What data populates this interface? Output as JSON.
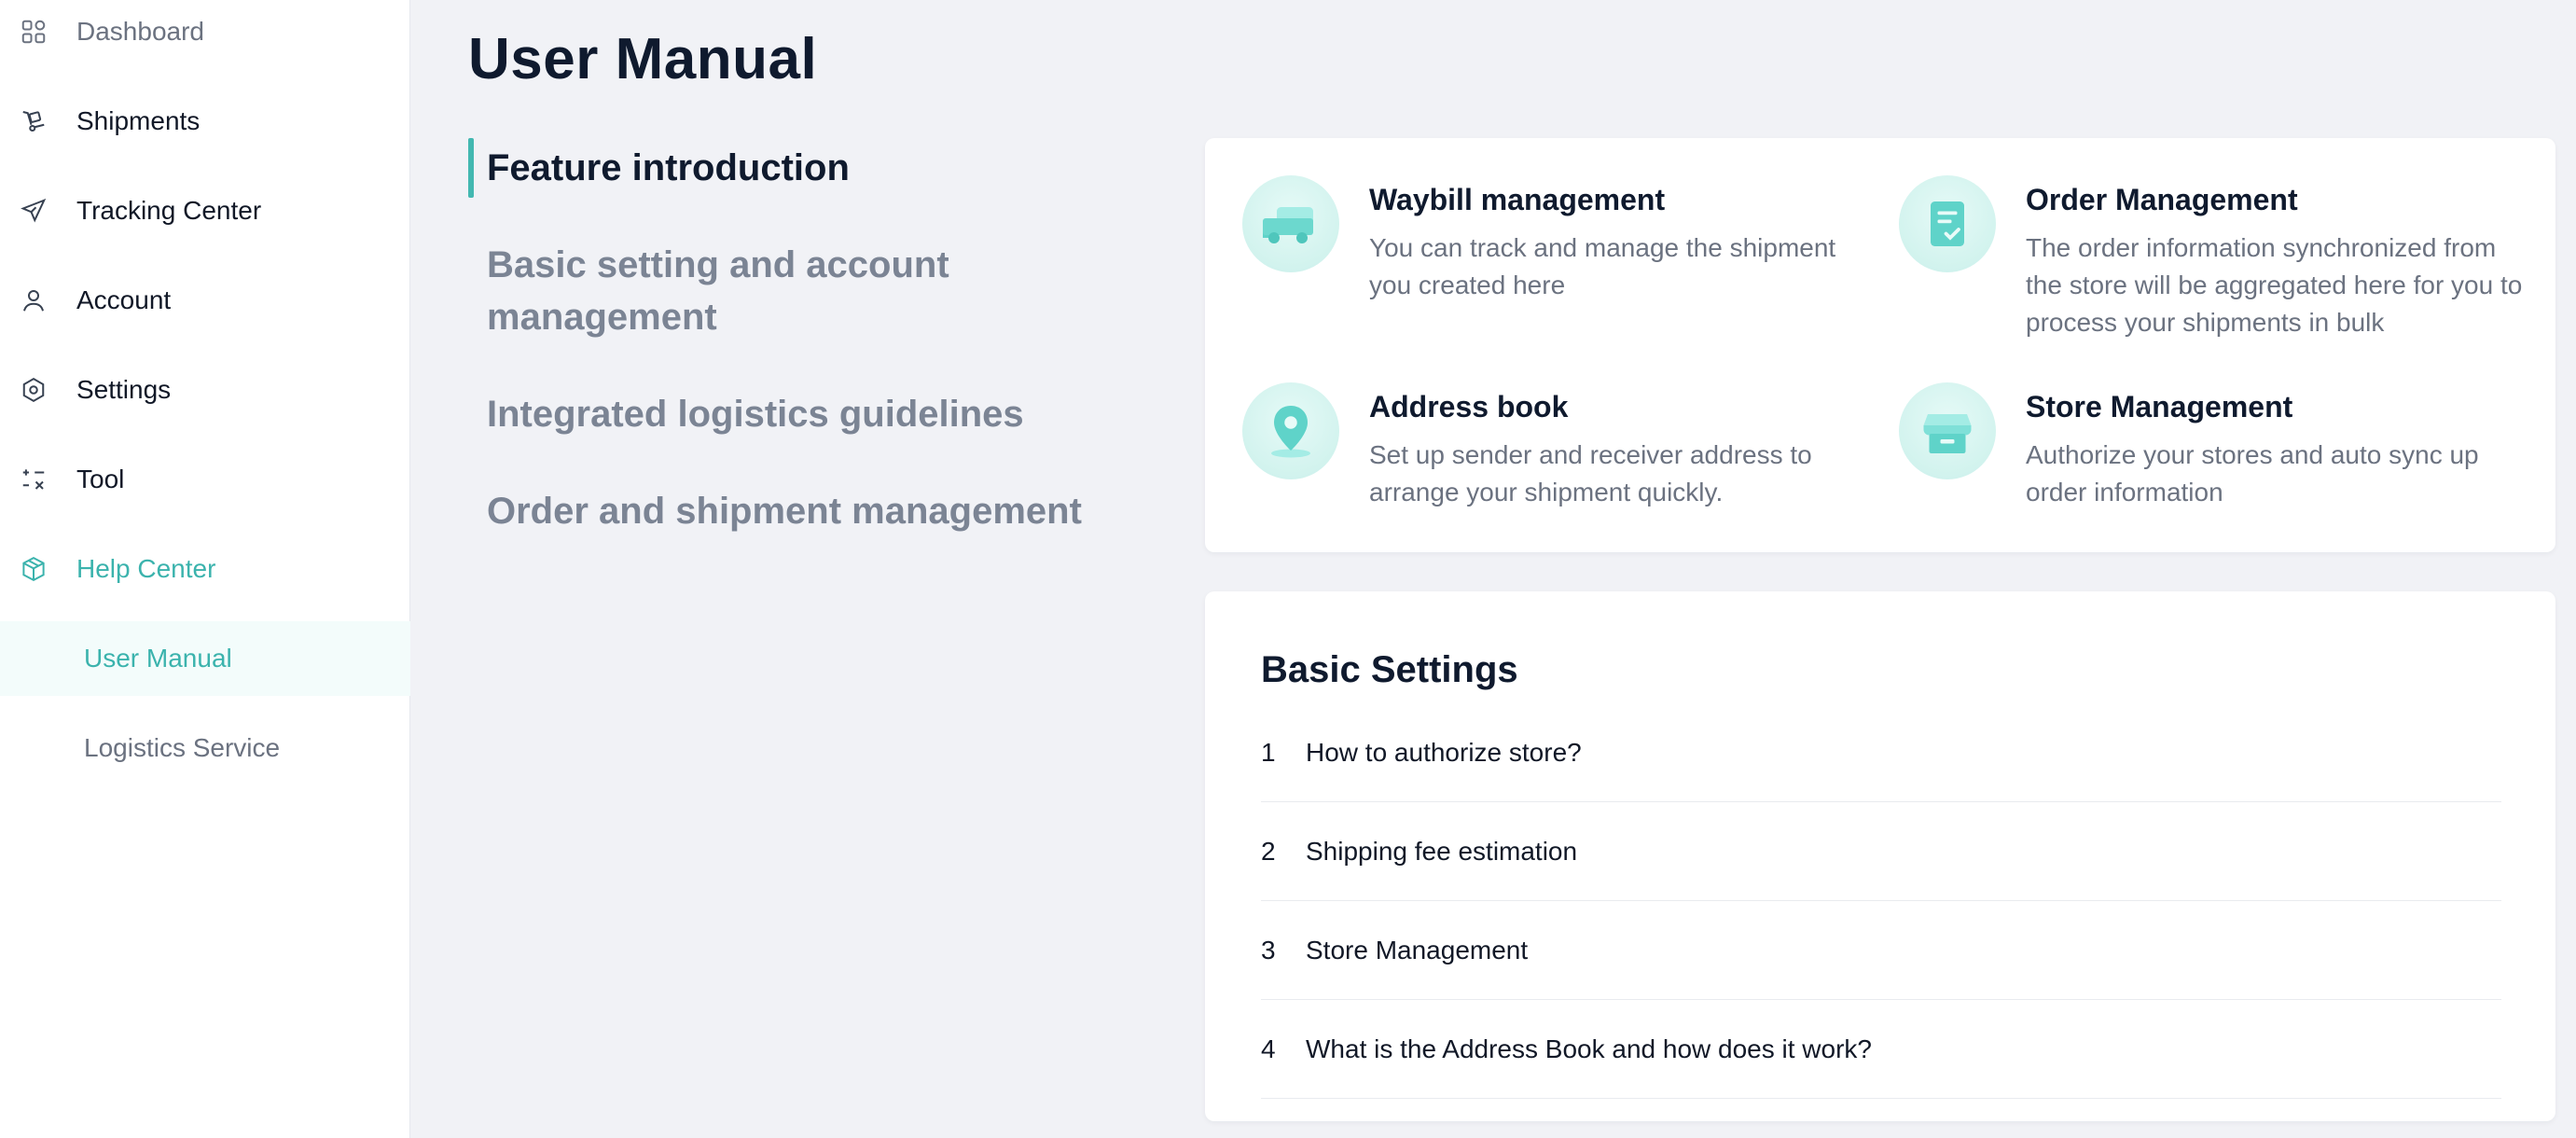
{
  "sidebar": {
    "items": [
      {
        "label": "Dashboard",
        "icon": "dashboard-icon"
      },
      {
        "label": "Shipments",
        "icon": "shipments-icon"
      },
      {
        "label": "Tracking Center",
        "icon": "send-icon"
      },
      {
        "label": "Account",
        "icon": "user-icon"
      },
      {
        "label": "Settings",
        "icon": "hexagon-gear-icon"
      },
      {
        "label": "Tool",
        "icon": "tool-icon"
      },
      {
        "label": "Help Center",
        "icon": "box-icon"
      }
    ],
    "sub_items": [
      {
        "label": "User Manual"
      },
      {
        "label": "Logistics Service"
      }
    ]
  },
  "main": {
    "title": "User Manual",
    "toc": [
      "Feature introduction",
      "Basic setting and account management",
      "Integrated logistics guidelines",
      "Order and shipment management"
    ],
    "features": [
      {
        "title": "Waybill management",
        "desc": "You can track and manage the shipment you created here",
        "icon": "truck-icon"
      },
      {
        "title": "Order Management",
        "desc": "The order information synchronized from the store will be aggregated here for you to process your shipments in bulk",
        "icon": "clipboard-check-icon"
      },
      {
        "title": "Address book",
        "desc": "Set up sender and receiver address to arrange your shipment quickly.",
        "icon": "location-pin-icon"
      },
      {
        "title": "Store Management",
        "desc": "Authorize your stores and auto sync up order information",
        "icon": "store-icon"
      }
    ],
    "basic_settings": {
      "title": "Basic Settings",
      "questions": [
        {
          "num": "1",
          "text": "How to authorize store?"
        },
        {
          "num": "2",
          "text": "Shipping fee estimation"
        },
        {
          "num": "3",
          "text": "Store Management"
        },
        {
          "num": "4",
          "text": "What is the Address Book and how does it work?"
        }
      ]
    }
  },
  "colors": {
    "accent": "#3bb3ad",
    "accent_light": "#7fe0d8",
    "muted_text": "#6b7280",
    "background": "#f1f2f6"
  }
}
